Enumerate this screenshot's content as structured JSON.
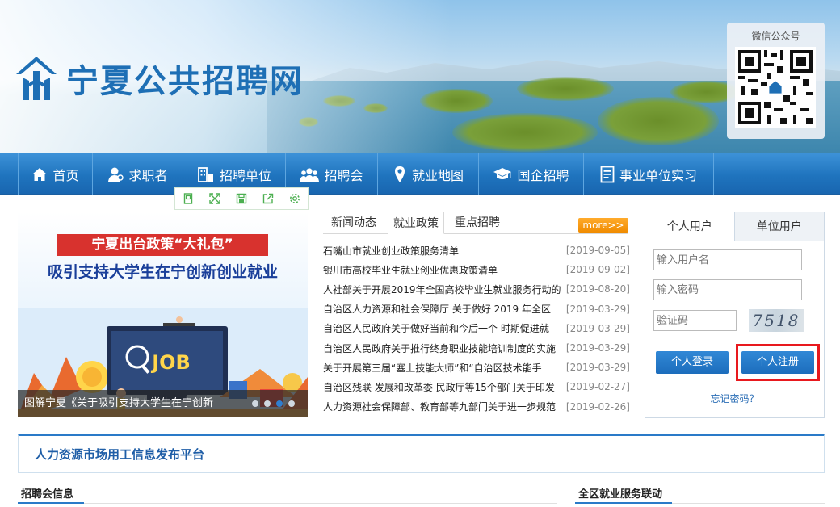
{
  "header": {
    "site_title": "宁夏公共招聘网",
    "wechat_caption": "微信公众号"
  },
  "nav": {
    "items": [
      {
        "label": "首页",
        "icon": "home-icon"
      },
      {
        "label": "求职者",
        "icon": "user-icon"
      },
      {
        "label": "招聘单位",
        "icon": "building-icon"
      },
      {
        "label": "招聘会",
        "icon": "group-icon"
      },
      {
        "label": "就业地图",
        "icon": "map-pin-icon"
      },
      {
        "label": "国企招聘",
        "icon": "graduation-icon"
      },
      {
        "label": "事业单位实习",
        "icon": "document-icon"
      }
    ]
  },
  "toolbar": {
    "icons": [
      "page-icon",
      "expand-icon",
      "save-icon",
      "share-icon",
      "settings-icon"
    ]
  },
  "carousel": {
    "headline": "宁夏出台政策“大礼包”",
    "subheadline": "吸引支持大学生在宁创新创业就业",
    "badge": "JOB",
    "caption": "图解宁夏《关于吸引支持大学生在宁创新",
    "slide_count": 4,
    "active_slide": 3
  },
  "news": {
    "tabs": [
      "新闻动态",
      "就业政策",
      "重点招聘"
    ],
    "active_tab": 1,
    "more_label": "more>>",
    "items": [
      {
        "title": "石嘴山市就业创业政策服务清单",
        "date": "[2019-09-05]"
      },
      {
        "title": "银川市高校毕业生就业创业优惠政策清单",
        "date": "[2019-09-02]"
      },
      {
        "title": "人社部关于开展2019年全国高校毕业生就业服务行动的",
        "date": "[2019-08-20]"
      },
      {
        "title": "自治区人力资源和社会保障厅 关于做好 2019 年全区",
        "date": "[2019-03-29]"
      },
      {
        "title": "自治区人民政府关于做好当前和今后一个 时期促进就",
        "date": "[2019-03-29]"
      },
      {
        "title": "自治区人民政府关于推行终身职业技能培训制度的实施",
        "date": "[2019-03-29]"
      },
      {
        "title": "关于开展第三届“塞上技能大师”和“自治区技术能手",
        "date": "[2019-03-29]"
      },
      {
        "title": "自治区残联 发展和改革委 民政厅等15个部门关于印发",
        "date": "[2019-02-27]"
      },
      {
        "title": "人力资源社会保障部、教育部等九部门关于进一步规范",
        "date": "[2019-02-26]"
      }
    ]
  },
  "login": {
    "tabs": [
      "个人用户",
      "单位用户"
    ],
    "username_placeholder": "输入用户名",
    "password_placeholder": "输入密码",
    "captcha_placeholder": "验证码",
    "captcha_text": "7518",
    "login_label": "个人登录",
    "register_label": "个人注册",
    "forgot_label": "忘记密码？"
  },
  "platform": {
    "title": "人力资源市场用工信息发布平台"
  },
  "sections": {
    "job_fair": "招聘会信息",
    "linkage": "全区就业服务联动"
  },
  "colors": {
    "brand_blue": "#1e6fb5",
    "nav_blue": "#1f74be",
    "accent_orange": "#f08b00",
    "highlight_red": "#e8191e"
  }
}
